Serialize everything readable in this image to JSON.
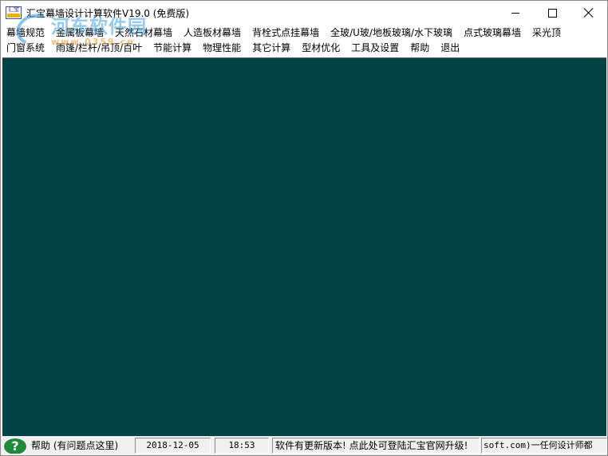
{
  "window": {
    "title": "汇宝幕墙设计计算软件V19.0 (免费版)",
    "icon_label": "汇宝",
    "client_bg": "#034345"
  },
  "watermark": {
    "text": "河东软件园",
    "url": "www.0359.cn"
  },
  "menu": {
    "row1": [
      "幕墙规范",
      "金属板幕墙",
      "天然石材幕墙",
      "人造板材幕墙",
      "背栓式点挂幕墙",
      "全玻/U玻/地板玻璃/水下玻璃",
      "点式玻璃幕墙",
      "采光顶"
    ],
    "row2": [
      "门窗系统",
      "雨篷/栏杆/吊顶/百叶",
      "节能计算",
      "物理性能",
      "其它计算",
      "型材优化",
      "工具及设置",
      "帮助",
      "退出"
    ]
  },
  "status": {
    "help": "帮助 (有问题点这里)",
    "date": "2018-12-05",
    "time": "18:53",
    "update": "软件有更新版本! 点此处可登陆汇宝官网升级!",
    "marquee": "soft.com)一任何设计师都"
  }
}
